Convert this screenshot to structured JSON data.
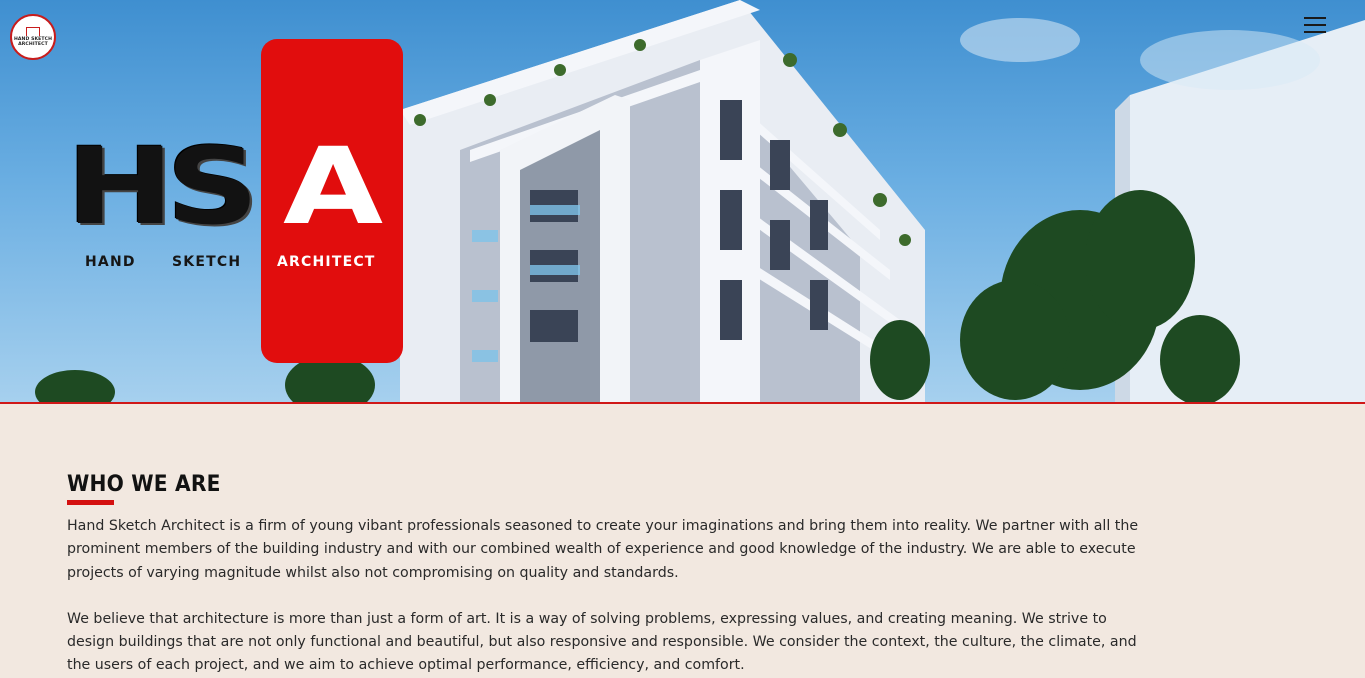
{
  "site": {
    "logo_lines": [
      "HAND SKETCH",
      "ARCHITECT"
    ],
    "menu_icon": "hamburger-icon"
  },
  "hero": {
    "brand_letters": [
      "H",
      "S",
      "A"
    ],
    "brand_words": [
      "HAND",
      "SKETCH",
      "ARCHITECT"
    ]
  },
  "about": {
    "heading": "WHO WE ARE",
    "paragraphs": [
      "Hand Sketch Architect is a firm of young vibant professionals seasoned to create your imaginations and bring them into reality. We partner with all the prominent members of the building industry and with our combined wealth of experience and good knowledge of the industry. We are able to execute projects of varying magnitude whilst also not compromising on quality and standards.",
      "We believe that architecture is more than just a form of art. It is a way of solving problems, expressing values, and creating meaning. We strive to design buildings that are not only functional and beautiful, but also responsive and responsible. We consider the context, the culture, the climate, and the users of each project, and we aim to achieve optimal performance, efficiency, and comfort."
    ]
  },
  "colors": {
    "accent": "#e10d0d",
    "page_background": "#f2e8e0",
    "text": "#2a2a2a"
  }
}
